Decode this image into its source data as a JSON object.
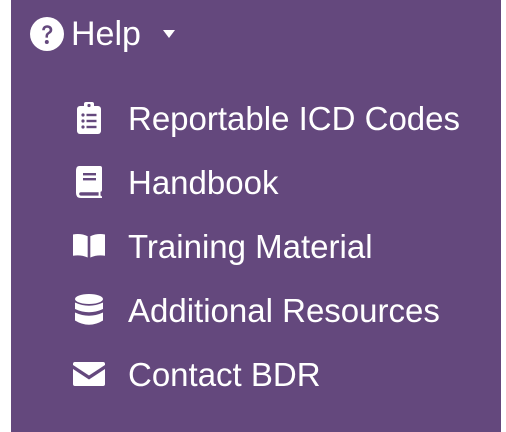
{
  "menu": {
    "header": {
      "label": "Help",
      "icon": "question-circle-icon",
      "toggle_icon": "caret-down-icon"
    },
    "items": [
      {
        "label": "Reportable ICD Codes",
        "icon": "clipboard-list-icon"
      },
      {
        "label": "Handbook",
        "icon": "book-icon"
      },
      {
        "label": "Training Material",
        "icon": "book-open-icon"
      },
      {
        "label": "Additional Resources",
        "icon": "database-icon"
      },
      {
        "label": "Contact BDR",
        "icon": "envelope-icon"
      }
    ]
  },
  "colors": {
    "panel_background": "#64487d",
    "text": "#ffffff"
  }
}
